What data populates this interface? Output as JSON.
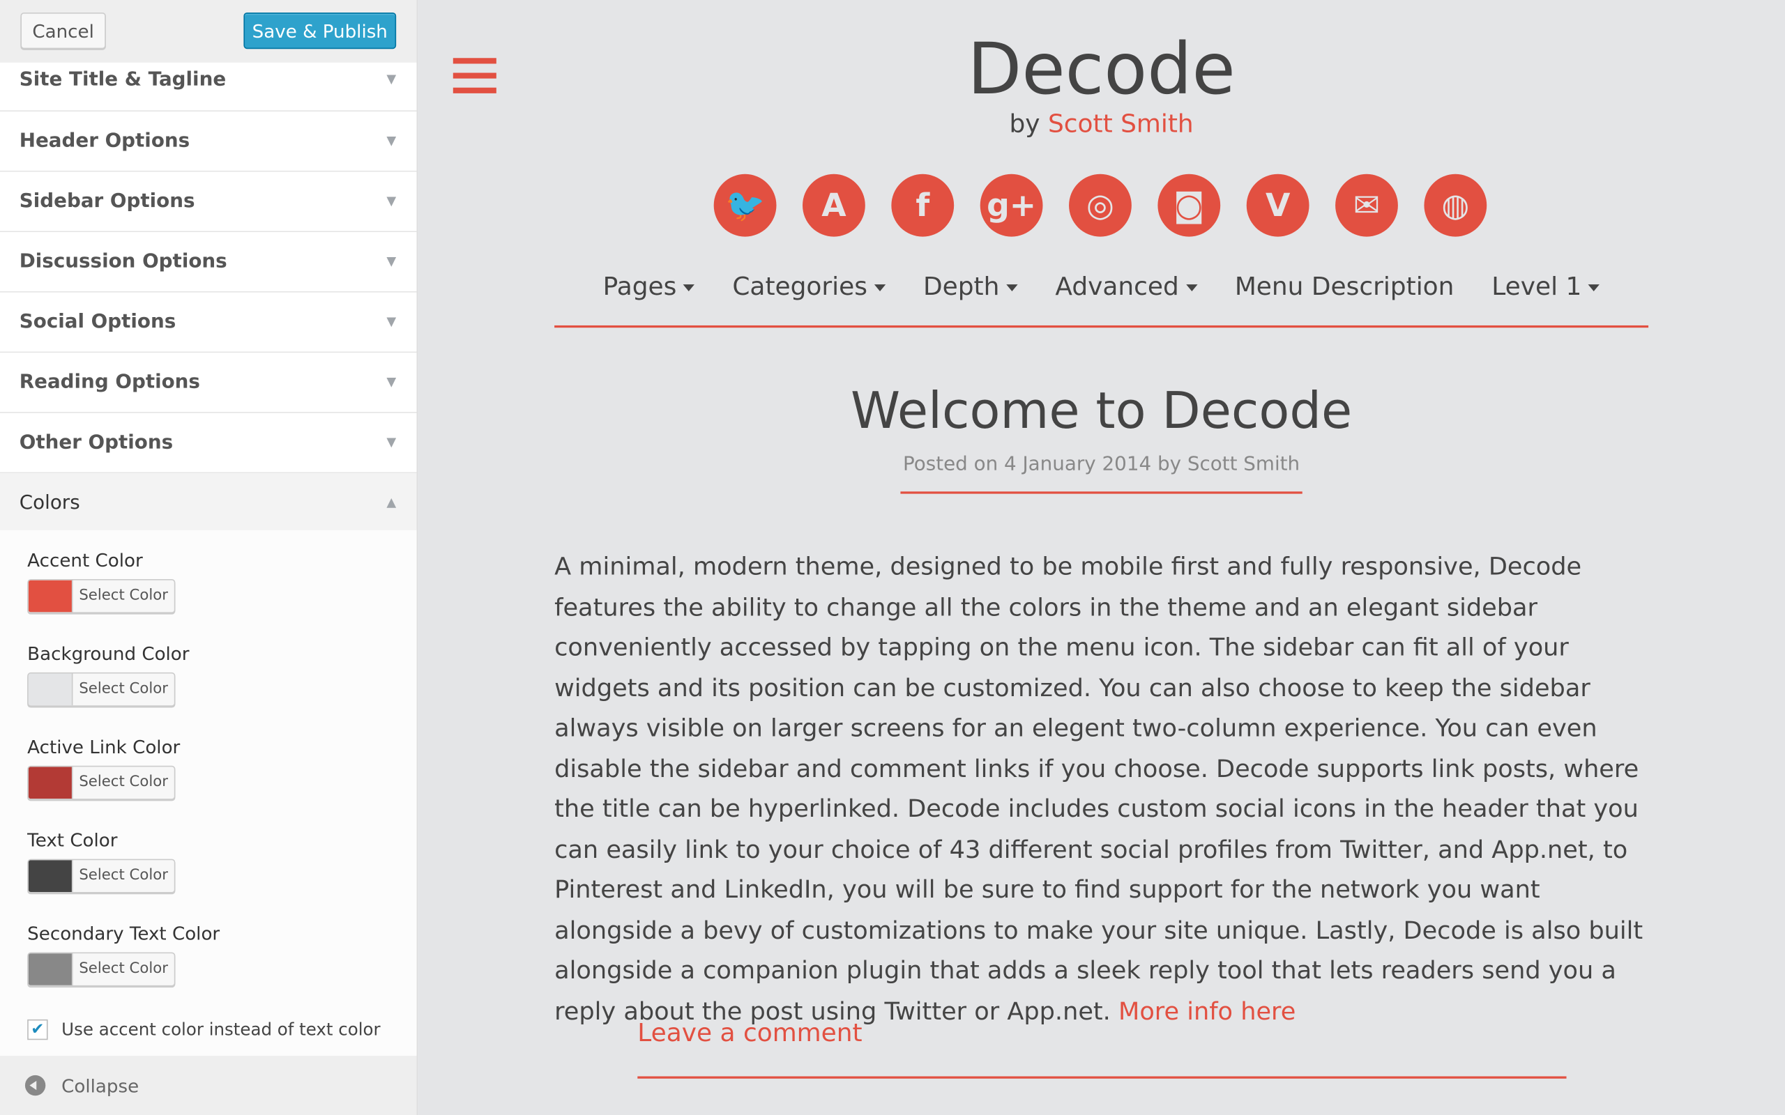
{
  "customizer": {
    "cancel_label": "Cancel",
    "save_label": "Save & Publish",
    "sections": [
      "Site Title & Tagline",
      "Header Options",
      "Sidebar Options",
      "Discussion Options",
      "Social Options",
      "Reading Options",
      "Other Options"
    ],
    "colors_section": "Colors",
    "color_settings": [
      {
        "label": "Accent Color",
        "value": "#e25041",
        "button": "Select Color"
      },
      {
        "label": "Background Color",
        "value": "#e4e5e7",
        "button": "Select Color"
      },
      {
        "label": "Active Link Color",
        "value": "#b33a35",
        "button": "Select Color"
      },
      {
        "label": "Text Color",
        "value": "#444444",
        "button": "Select Color"
      },
      {
        "label": "Secondary Text Color",
        "value": "#888888",
        "button": "Select Color"
      }
    ],
    "checkbox_label": "Use accent color instead of text color",
    "checkbox_checked": true,
    "collapse_label": "Collapse"
  },
  "site": {
    "title": "Decode",
    "by": "by",
    "author": "Scott Smith",
    "social_icons": [
      "twitter-icon",
      "appnet-icon",
      "facebook-icon",
      "google-plus-icon",
      "dribbble-icon",
      "instagram-icon",
      "vine-icon",
      "email-icon",
      "website-icon"
    ],
    "nav": [
      {
        "label": "Pages",
        "dropdown": true
      },
      {
        "label": "Categories",
        "dropdown": true
      },
      {
        "label": "Depth",
        "dropdown": true
      },
      {
        "label": "Advanced",
        "dropdown": true
      },
      {
        "label": "Menu Description",
        "dropdown": false
      },
      {
        "label": "Level 1",
        "dropdown": true
      }
    ],
    "post_title": "Welcome to Decode",
    "post_meta": "Posted on 4 January 2014 by Scott Smith",
    "post_body": "A minimal, modern theme, designed to be mobile first and fully responsive, Decode features the ability to change all the colors in the theme and an elegant sidebar conveniently accessed by tapping on the menu icon. The sidebar can fit all of your widgets and its position can be customized. You can also choose to keep the sidebar always visible on larger screens for an elegent two-column experience. You can even disable the sidebar and comment links if you choose. Decode supports link posts, where the title can be hyperlinked. Decode includes custom social icons in the header that you can easily link to your choice of 43 different social profiles from Twitter, and App.net, to Pinterest and LinkedIn, you will be sure to find support for the network you want alongside a bevy of customizations to make your site unique. Lastly, Decode is also built alongside a companion plugin that adds a sleek reply tool that lets readers send you a reply about the post using Twitter or App.net.",
    "more_link": "More info here",
    "leave_comment": "Leave a comment",
    "accent": "#e25041"
  }
}
